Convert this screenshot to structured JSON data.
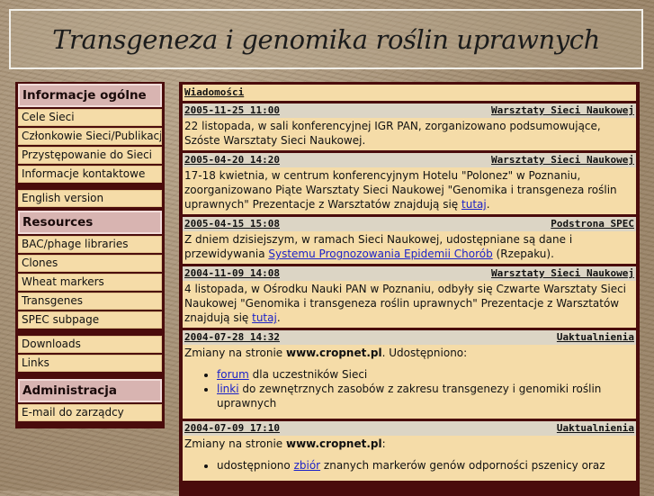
{
  "header": {
    "title": "Transgeneza i genomika roślin uprawnych"
  },
  "sidebar": {
    "sections": [
      {
        "title": "Informacje ogólne",
        "items": [
          "Cele Sieci",
          "Członkowie Sieci/Publikacje",
          "Przystępowanie do Sieci",
          "Informacje kontaktowe"
        ]
      },
      {
        "title": "",
        "items": [
          "English version"
        ]
      },
      {
        "title": "Resources",
        "items": [
          "BAC/phage libraries",
          "Clones",
          "Wheat markers",
          "Transgenes",
          "SPEC subpage"
        ]
      },
      {
        "title": "",
        "items": [
          "Downloads",
          "Links"
        ]
      },
      {
        "title": "Administracja",
        "items": [
          "E-mail do zarządcy"
        ]
      }
    ]
  },
  "news": {
    "heading": "Wiadomości",
    "entries": [
      {
        "date": "2005-11-25 11:00",
        "category": "Warsztaty Sieci Naukowej",
        "text": "22 listopada, w sali konferencyjnej IGR PAN, zorganizowano podsumowujące, Szóste Warsztaty Sieci Naukowej."
      },
      {
        "date": "2005-04-20 14:20",
        "category": "Warsztaty Sieci Naukowej",
        "text": "17-18 kwietnia, w centrum konferencyjnym Hotelu \"Polonez\" w Poznaniu, zoorganizowano Piąte Warsztaty Sieci Naukowej \"Genomika i transgeneza roślin uprawnych\" Prezentacje z Warsztatów znajdują się ",
        "link": "tutaj",
        "after": "."
      },
      {
        "date": "2005-04-15 15:08",
        "category": "Podstrona SPEC",
        "text": "Z dniem dzisiejszym, w ramach Sieci Naukowej, udostępniane są dane i przewidywania ",
        "link": "Systemu Prognozowania Epidemii Chorób",
        "after": " (Rzepaku)."
      },
      {
        "date": "2004-11-09 14:08",
        "category": "Warsztaty Sieci Naukowej",
        "text": "4 listopada, w Ośrodku Nauki PAN w Poznaniu, odbyły się Czwarte Warsztaty Sieci Naukowej \"Genomika i transgeneza roślin uprawnych\" Prezentacje z Warsztatów znajdują się ",
        "link": "tutaj",
        "after": "."
      },
      {
        "date": "2004-07-28 14:32",
        "category": "Uaktualnienia",
        "intro": "Zmiany na stronie ",
        "site": "www.cropnet.pl",
        "intro_after": ". Udostępniono:",
        "bullets": [
          {
            "link": "forum",
            "text": " dla uczestników Sieci"
          },
          {
            "link": "linki",
            "text": " do zewnętrznych zasobów z zakresu transgenezy i genomiki roślin uprawnych"
          }
        ]
      },
      {
        "date": "2004-07-09 17:10",
        "category": "Uaktualnienia",
        "intro": "Zmiany na stronie ",
        "site": "www.cropnet.pl",
        "intro_after": ":",
        "bullets": [
          {
            "pre": "udostępniono ",
            "link": "zbiór",
            "text": " znanych markerów genów odporności pszenicy oraz"
          }
        ]
      }
    ]
  }
}
